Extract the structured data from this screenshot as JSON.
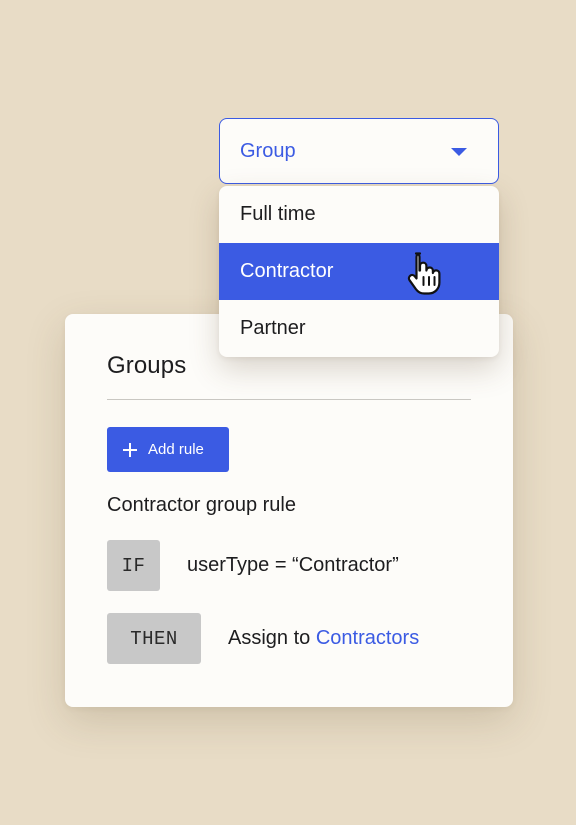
{
  "group_select": {
    "value": "Group",
    "options": [
      "Full time",
      "Contractor",
      "Partner"
    ],
    "highlighted": "Contractor"
  },
  "card": {
    "title": "Groups",
    "add_rule_label": "Add rule",
    "rule_title": "Contractor group rule",
    "if_label": "IF",
    "condition": "userType = “Contractor”",
    "then_label": "THEN",
    "action_prefix": "Assign to",
    "action_target": "Contractors"
  },
  "colors": {
    "accent": "#3b5be3",
    "background": "#e8dcc6",
    "surface": "#fdfcf9",
    "chip": "#c8c8c8"
  },
  "icons": {
    "caret": "caret-down-icon",
    "add": "plus-icon",
    "pointer": "hand-pointer-cursor-icon"
  }
}
